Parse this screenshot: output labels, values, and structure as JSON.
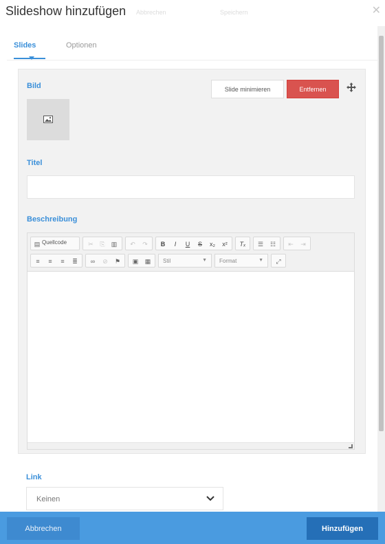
{
  "dialog": {
    "title": "Slideshow hinzufügen",
    "close_icon": "close-icon",
    "ghost_tabs": [
      "Abbrechen",
      "Speichern"
    ]
  },
  "tabs": [
    {
      "label": "Slides",
      "active": true
    },
    {
      "label": "Optionen",
      "active": false
    }
  ],
  "slide": {
    "image_label": "Bild",
    "minimize_label": "Slide minimieren",
    "remove_label": "Entfernen",
    "move_icon": "move-icon",
    "image_placeholder_icon": "image-icon",
    "title_label": "Titel",
    "title_value": "",
    "description_label": "Beschreibung",
    "description_value": ""
  },
  "editor": {
    "source_label": "Quellcode",
    "style_combo": "Stil",
    "format_combo": "Format",
    "toolbar_icons": [
      "cut-icon",
      "copy-icon",
      "paste-icon",
      "undo-icon",
      "redo-icon",
      "bold-icon",
      "italic-icon",
      "underline-icon",
      "strikethrough-icon",
      "subscript-icon",
      "superscript-icon",
      "remove-format-icon",
      "numbered-list-icon",
      "bullet-list-icon",
      "outdent-icon",
      "indent-icon",
      "align-left-icon",
      "align-center-icon",
      "align-right-icon",
      "justify-icon",
      "link-icon",
      "unlink-icon",
      "anchor-icon",
      "image-icon",
      "table-icon",
      "maximize-icon"
    ]
  },
  "link": {
    "label": "Link",
    "selected": "Keinen"
  },
  "footer": {
    "cancel_label": "Abbrechen",
    "add_label": "Hinzufügen"
  },
  "colors": {
    "accent": "#3a8fd9",
    "danger": "#d9534f",
    "footer": "#4a9be0",
    "primary_button": "#256fb7"
  }
}
